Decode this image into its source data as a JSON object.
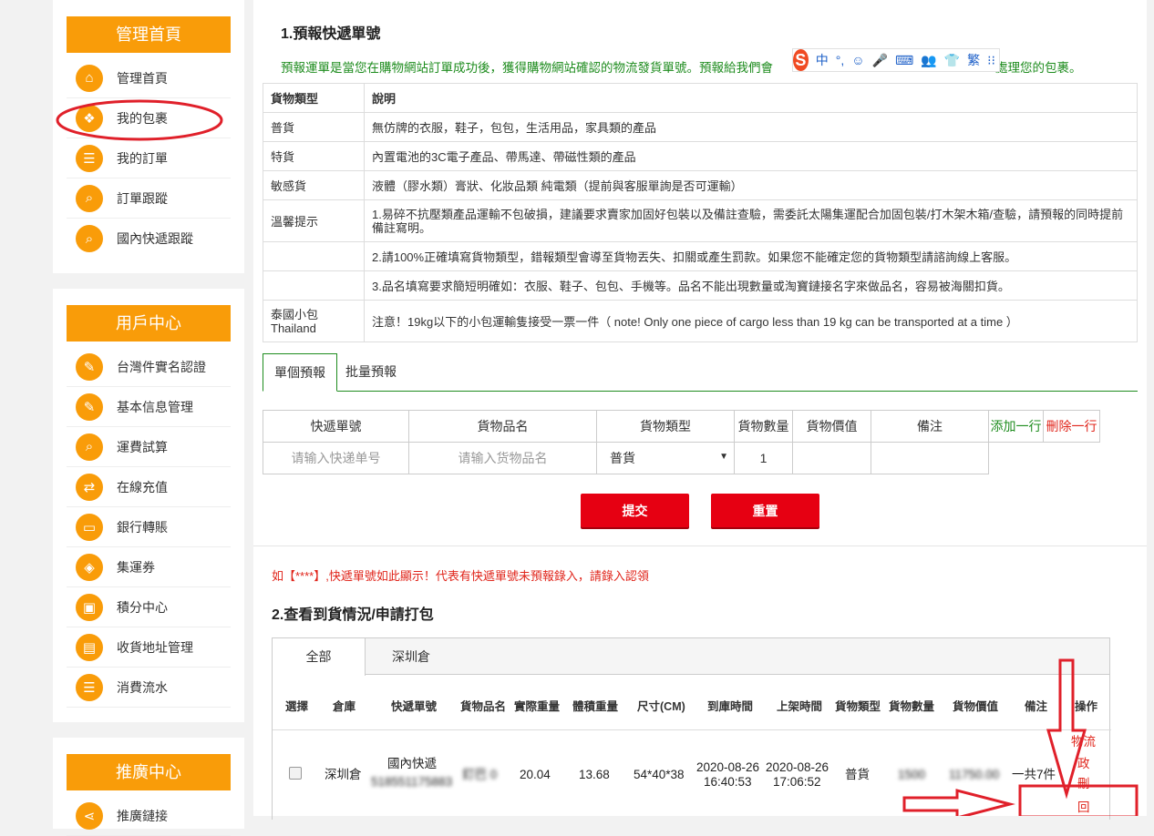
{
  "sidebar": {
    "panels": [
      {
        "title": "管理首頁",
        "items": [
          {
            "label": "管理首頁",
            "icon": "home-icon",
            "glyph": "⌂"
          },
          {
            "label": "我的包裹",
            "icon": "package-icon",
            "glyph": "❖"
          },
          {
            "label": "我的訂單",
            "icon": "list-icon",
            "glyph": "☰"
          },
          {
            "label": "訂單跟蹤",
            "icon": "search-icon",
            "glyph": "⌕"
          },
          {
            "label": "國內快遞跟蹤",
            "icon": "search-icon",
            "glyph": "⌕"
          }
        ]
      },
      {
        "title": "用戶中心",
        "items": [
          {
            "label": "台灣件實名認證",
            "icon": "edit-icon",
            "glyph": "✎"
          },
          {
            "label": "基本信息管理",
            "icon": "edit-icon",
            "glyph": "✎"
          },
          {
            "label": "運費試算",
            "icon": "search-icon",
            "glyph": "⌕"
          },
          {
            "label": "在線充值",
            "icon": "exchange-icon",
            "glyph": "⇄"
          },
          {
            "label": "銀行轉賬",
            "icon": "card-icon",
            "glyph": "▭"
          },
          {
            "label": "集運券",
            "icon": "coupon-icon",
            "glyph": "◈"
          },
          {
            "label": "積分中心",
            "icon": "gift-icon",
            "glyph": "▣"
          },
          {
            "label": "收貨地址管理",
            "icon": "address-card-icon",
            "glyph": "▤"
          },
          {
            "label": "消費流水",
            "icon": "list-icon",
            "glyph": "☰"
          }
        ]
      },
      {
        "title": "推廣中心",
        "items": [
          {
            "label": "推廣鏈接",
            "icon": "share-icon",
            "glyph": "⋖"
          }
        ]
      }
    ]
  },
  "section1": {
    "title": "1.預報快遞單號",
    "note": "預報運單是當您在購物網站訂單成功後，獲得購物網站確認的物流發貨單號。預報給我們會",
    "note_tail": "處理您的包裹。"
  },
  "ime": {
    "chars": [
      "中",
      "°,",
      "☺",
      "🎤",
      "⌨",
      "👥",
      "👕",
      "繁",
      "⁝⁝"
    ]
  },
  "info_table": {
    "header": [
      "貨物類型",
      "說明"
    ],
    "rows": [
      [
        "普貨",
        "無仿牌的衣服，鞋子，包包，生活用品，家具類的產品"
      ],
      [
        "特貨",
        "內置電池的3C電子產品、帶馬達、帶磁性類的產品"
      ],
      [
        "敏感貨",
        "液體（膠水類）膏狀、化妝品類 純電類（提前與客服單詢是否可運輸）"
      ],
      [
        "溫馨提示",
        "1.易碎不抗壓類產品運輸不包破損，建議要求賣家加固好包裝以及備註查驗，需委託太陽集運配合加固包裝/打木架木箱/查驗，請預報的同時提前備註寫明。"
      ],
      [
        "",
        "2.請100%正確填寫貨物類型，錯報類型會導至貨物丟失、扣關或產生罰款。如果您不能確定您的貨物類型請諮詢線上客服。"
      ],
      [
        "",
        "3.品名填寫要求簡短明確如：衣服、鞋子、包包、手機等。品名不能出現數量或淘寶鏈接名字來做品名，容易被海關扣貨。"
      ],
      [
        "泰國小包\nThailand",
        "注意！19kg以下的小包運輸隻接受一票一件（ note! Only one piece of cargo less than 19 kg can be transported at a time ）"
      ]
    ]
  },
  "tabs": [
    "單個預報",
    "批量預報"
  ],
  "form": {
    "headers": [
      "快遞單號",
      "貨物品名",
      "貨物類型",
      "貨物數量",
      "貨物價值",
      "備注"
    ],
    "add_row": "添加一行",
    "del_row": "刪除一行",
    "tracking_placeholder": "请输入快递单号",
    "name_placeholder": "请输入货物品名",
    "type_value": "普貨",
    "qty_value": "1",
    "submit": "提交",
    "reset": "重置"
  },
  "warning": "如【****】,快遞單號如此顯示！代表有快遞單號未預報錄入，請錄入認領",
  "section2": {
    "title": "2.查看到貨情況/申請打包",
    "tabs": [
      "全部",
      "深圳倉"
    ],
    "headers": [
      "選擇",
      "倉庫",
      "快遞單號",
      "貨物品名",
      "實際重量",
      "體積重量",
      "尺寸(CM)",
      "到庫時間",
      "上架時間",
      "貨物類型",
      "貨物數量",
      "貨物價值",
      "備注",
      "操作"
    ],
    "row": {
      "warehouse": "深圳倉",
      "carrier": "國內快遞",
      "tracking": "518551175883",
      "product": "釘巴 0",
      "actual_weight": "20.04",
      "vol_weight": "13.68",
      "size": "54*40*38",
      "arrive_date": "2020-08-26",
      "arrive_time": "16:40:53",
      "shelf_date": "2020-08-26",
      "shelf_time": "17:06:52",
      "type": "普貨",
      "qty": "1500",
      "value": "11750.00",
      "note": "一共7件",
      "actions": [
        "物流",
        "政",
        "刪",
        "回"
      ]
    }
  },
  "colors": {
    "orange": "#f99c09",
    "green": "#1e8c1e",
    "red": "#e60012",
    "annotation": "#e0202a"
  }
}
